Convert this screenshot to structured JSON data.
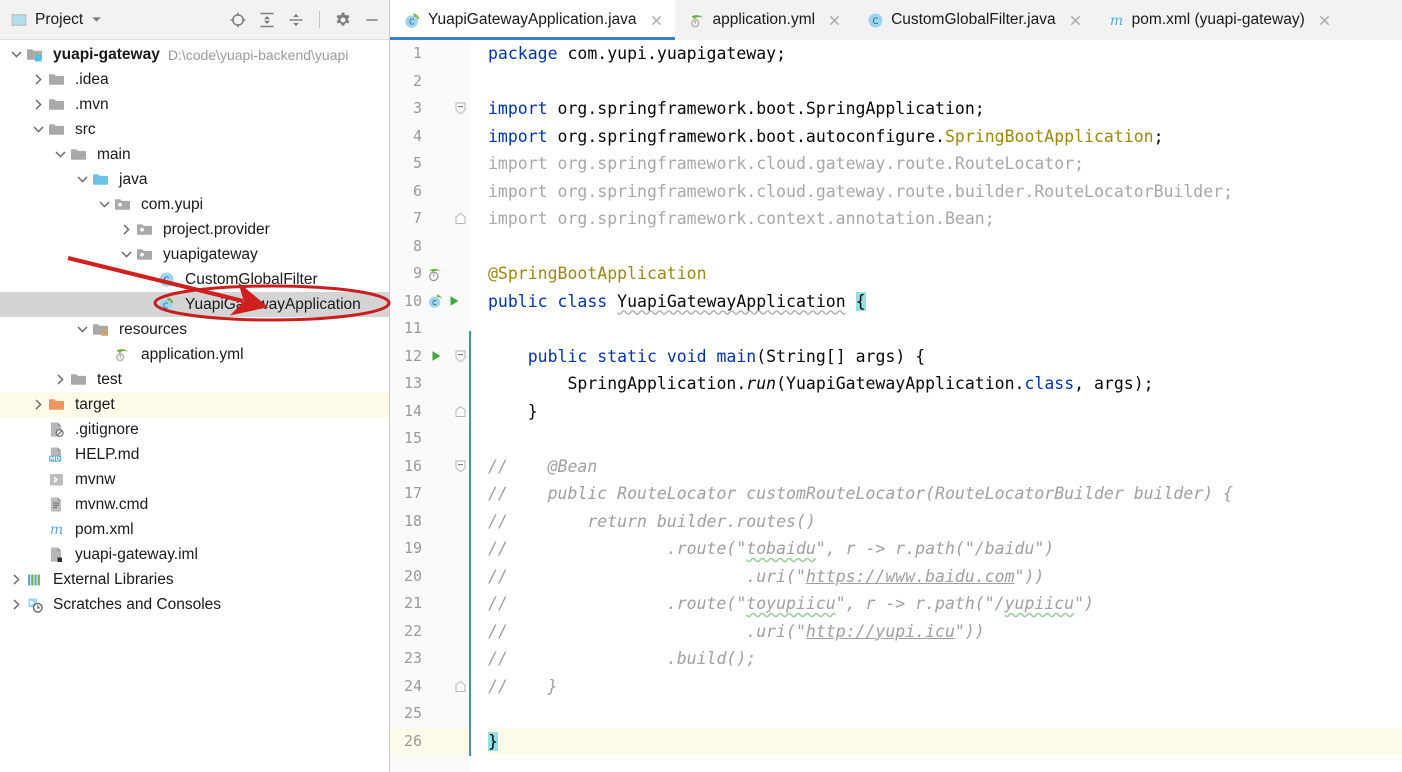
{
  "project_panel": {
    "title": "Project",
    "title_icon": "project-window-icon",
    "dropdown_icon": "chevron-down-icon",
    "toolbar_icons": [
      {
        "name": "locate-file-icon",
        "tooltip": "Select Opened File"
      },
      {
        "name": "expand-all-icon",
        "tooltip": "Expand All"
      },
      {
        "name": "collapse-all-icon",
        "tooltip": "Collapse All"
      },
      {
        "name": "settings-gear-icon",
        "tooltip": "Options"
      },
      {
        "name": "minimize-icon",
        "tooltip": "Hide"
      }
    ],
    "tree": [
      {
        "label": "yuapi-gateway",
        "sub": "D:\\code\\yuapi-backend\\yuapi",
        "depth": 0,
        "state": "expanded",
        "icon": "module-folder-icon",
        "bold": true,
        "selected": false,
        "highlight": false
      },
      {
        "label": ".idea",
        "sub": "",
        "depth": 1,
        "state": "collapsed",
        "icon": "folder-icon",
        "bold": false,
        "selected": false,
        "highlight": false
      },
      {
        "label": ".mvn",
        "sub": "",
        "depth": 1,
        "state": "collapsed",
        "icon": "folder-icon",
        "bold": false,
        "selected": false,
        "highlight": false
      },
      {
        "label": "src",
        "sub": "",
        "depth": 1,
        "state": "expanded",
        "icon": "folder-icon",
        "bold": false,
        "selected": false,
        "highlight": false
      },
      {
        "label": "main",
        "sub": "",
        "depth": 2,
        "state": "expanded",
        "icon": "folder-icon",
        "bold": false,
        "selected": false,
        "highlight": false
      },
      {
        "label": "java",
        "sub": "",
        "depth": 3,
        "state": "expanded",
        "icon": "source-root-icon",
        "bold": false,
        "selected": false,
        "highlight": false
      },
      {
        "label": "com.yupi",
        "sub": "",
        "depth": 4,
        "state": "expanded",
        "icon": "package-icon",
        "bold": false,
        "selected": false,
        "highlight": false
      },
      {
        "label": "project.provider",
        "sub": "",
        "depth": 5,
        "state": "collapsed",
        "icon": "package-icon",
        "bold": false,
        "selected": false,
        "highlight": false
      },
      {
        "label": "yuapigateway",
        "sub": "",
        "depth": 5,
        "state": "expanded",
        "icon": "package-icon",
        "bold": false,
        "selected": false,
        "highlight": false
      },
      {
        "label": "CustomGlobalFilter",
        "sub": "",
        "depth": 6,
        "state": "leaf",
        "icon": "java-class-icon",
        "bold": false,
        "selected": false,
        "highlight": false
      },
      {
        "label": "YuapiGatewayApplication",
        "sub": "",
        "depth": 6,
        "state": "leaf",
        "icon": "spring-boot-class-icon",
        "bold": false,
        "selected": true,
        "highlight": false
      },
      {
        "label": "resources",
        "sub": "",
        "depth": 3,
        "state": "expanded",
        "icon": "resources-root-icon",
        "bold": false,
        "selected": false,
        "highlight": false
      },
      {
        "label": "application.yml",
        "sub": "",
        "depth": 4,
        "state": "leaf",
        "icon": "spring-yaml-icon",
        "bold": false,
        "selected": false,
        "highlight": false
      },
      {
        "label": "test",
        "sub": "",
        "depth": 2,
        "state": "collapsed",
        "icon": "folder-icon",
        "bold": false,
        "selected": false,
        "highlight": false
      },
      {
        "label": "target",
        "sub": "",
        "depth": 1,
        "state": "collapsed",
        "icon": "excluded-folder-icon",
        "bold": false,
        "selected": false,
        "highlight": true
      },
      {
        "label": ".gitignore",
        "sub": "",
        "depth": 1,
        "state": "leaf",
        "icon": "gitignore-file-icon",
        "bold": false,
        "selected": false,
        "highlight": false
      },
      {
        "label": "HELP.md",
        "sub": "",
        "depth": 1,
        "state": "leaf",
        "icon": "markdown-file-icon",
        "bold": false,
        "selected": false,
        "highlight": false
      },
      {
        "label": "mvnw",
        "sub": "",
        "depth": 1,
        "state": "leaf",
        "icon": "shell-script-icon",
        "bold": false,
        "selected": false,
        "highlight": false
      },
      {
        "label": "mvnw.cmd",
        "sub": "",
        "depth": 1,
        "state": "leaf",
        "icon": "text-file-icon",
        "bold": false,
        "selected": false,
        "highlight": false
      },
      {
        "label": "pom.xml",
        "sub": "",
        "depth": 1,
        "state": "leaf",
        "icon": "maven-file-icon",
        "bold": false,
        "selected": false,
        "highlight": false
      },
      {
        "label": "yuapi-gateway.iml",
        "sub": "",
        "depth": 1,
        "state": "leaf",
        "icon": "iml-file-icon",
        "bold": false,
        "selected": false,
        "highlight": false
      },
      {
        "label": "External Libraries",
        "sub": "",
        "depth": 0,
        "state": "collapsed",
        "icon": "libraries-icon",
        "bold": false,
        "selected": false,
        "highlight": false
      },
      {
        "label": "Scratches and Consoles",
        "sub": "",
        "depth": 0,
        "state": "collapsed",
        "icon": "scratches-icon",
        "bold": false,
        "selected": false,
        "highlight": false
      }
    ]
  },
  "tabs": [
    {
      "label": "YuapiGatewayApplication.java",
      "icon": "spring-boot-class-icon",
      "active": true,
      "closable": true
    },
    {
      "label": "application.yml",
      "icon": "spring-yaml-icon",
      "active": false,
      "closable": true
    },
    {
      "label": "CustomGlobalFilter.java",
      "icon": "java-class-icon",
      "active": false,
      "closable": true
    },
    {
      "label": "pom.xml (yuapi-gateway)",
      "icon": "maven-file-icon",
      "active": false,
      "closable": true
    }
  ],
  "editor": {
    "file_name": "YuapiGatewayApplication.java",
    "first_line": 1,
    "last_line": 26,
    "caret_line": 26,
    "lines": [
      {
        "n": 1,
        "text": "package com.yupi.yuapigateway;"
      },
      {
        "n": 2,
        "text": ""
      },
      {
        "n": 3,
        "text": "import org.springframework.boot.SpringApplication;"
      },
      {
        "n": 4,
        "text": "import org.springframework.boot.autoconfigure.SpringBootApplication;"
      },
      {
        "n": 5,
        "text": "import org.springframework.cloud.gateway.route.RouteLocator;"
      },
      {
        "n": 6,
        "text": "import org.springframework.cloud.gateway.route.builder.RouteLocatorBuilder;"
      },
      {
        "n": 7,
        "text": "import org.springframework.context.annotation.Bean;"
      },
      {
        "n": 8,
        "text": ""
      },
      {
        "n": 9,
        "text": "@SpringBootApplication"
      },
      {
        "n": 10,
        "text": "public class YuapiGatewayApplication {"
      },
      {
        "n": 11,
        "text": ""
      },
      {
        "n": 12,
        "text": "    public static void main(String[] args) {"
      },
      {
        "n": 13,
        "text": "        SpringApplication.run(YuapiGatewayApplication.class, args);"
      },
      {
        "n": 14,
        "text": "    }"
      },
      {
        "n": 15,
        "text": ""
      },
      {
        "n": 16,
        "text": "//    @Bean"
      },
      {
        "n": 17,
        "text": "//    public RouteLocator customRouteLocator(RouteLocatorBuilder builder) {"
      },
      {
        "n": 18,
        "text": "//        return builder.routes()"
      },
      {
        "n": 19,
        "text": "//                .route(\"tobaidu\", r -> r.path(\"/baidu\")"
      },
      {
        "n": 20,
        "text": "//                        .uri(\"https://www.baidu.com\"))"
      },
      {
        "n": 21,
        "text": "//                .route(\"toyupiicu\", r -> r.path(\"/yupiicu\")"
      },
      {
        "n": 22,
        "text": "//                        .uri(\"http://yupi.icu\"))"
      },
      {
        "n": 23,
        "text": "//                .build();"
      },
      {
        "n": 24,
        "text": "//    }"
      },
      {
        "n": 25,
        "text": ""
      },
      {
        "n": 26,
        "text": "}"
      }
    ],
    "gutter_markers": [
      {
        "line": 9,
        "icon": "spring-bean-icon"
      },
      {
        "line": 10,
        "icon": "spring-boot-class-icon"
      },
      {
        "line": 10,
        "icon": "run-gutter-icon"
      },
      {
        "line": 12,
        "icon": "run-gutter-icon"
      }
    ],
    "fold_markers": [
      {
        "line": 3,
        "type": "fold-collapse"
      },
      {
        "line": 7,
        "type": "fold-end"
      },
      {
        "line": 12,
        "type": "fold-collapse"
      },
      {
        "line": 14,
        "type": "fold-end"
      },
      {
        "line": 16,
        "type": "fold-collapse"
      },
      {
        "line": 24,
        "type": "fold-end"
      }
    ]
  },
  "annotations": {
    "arrow": {
      "name": "red-arrow-annotation",
      "color": "#d01f1f"
    },
    "ellipse": {
      "name": "red-ellipse-annotation",
      "color": "#c81e1e",
      "target_label": "YuapiGatewayApplication"
    }
  },
  "colors": {
    "accent_tab_underline": "#3c7fd0",
    "selection_gray": "#d4d4d4",
    "caret_row_yellow": "#fcfae8",
    "keyword_blue": "#0033b3",
    "annotation_gold": "#9e880d",
    "string_green": "#067d17",
    "comment_gray": "#a0a0a0",
    "brace_match_teal": "#93e0e0",
    "scope_bar_teal": "#3f9e8f",
    "annotation_red": "#d01f1f"
  }
}
